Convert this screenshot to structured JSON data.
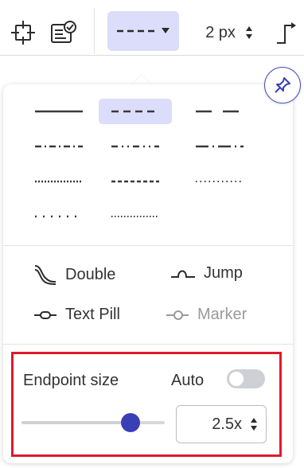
{
  "toolbar": {
    "width_value": "2 px",
    "icons": [
      "crop-frame-icon",
      "checklist-icon",
      "dash-style-dropdown-icon",
      "connector-icon"
    ]
  },
  "panel": {
    "patterns": [
      {
        "name": "solid",
        "selected": false
      },
      {
        "name": "dash",
        "selected": true
      },
      {
        "name": "long-dash",
        "selected": false
      },
      {
        "name": "dash-dot",
        "selected": false
      },
      {
        "name": "dash-dot-dot",
        "selected": false
      },
      {
        "name": "long-dash-dot",
        "selected": false
      },
      {
        "name": "dense-dot",
        "selected": false
      },
      {
        "name": "short-dash",
        "selected": false
      },
      {
        "name": "fine-dot",
        "selected": false
      },
      {
        "name": "sparse-dot",
        "selected": false
      },
      {
        "name": "micro-dot",
        "selected": false
      }
    ],
    "styles": {
      "double": "Double",
      "jump": "Jump",
      "text_pill": "Text Pill",
      "marker": "Marker"
    },
    "endpoint": {
      "label": "Endpoint size",
      "auto_label": "Auto",
      "auto_enabled": false,
      "slider_fraction": 0.76,
      "value": "2.5x"
    }
  },
  "colors": {
    "accent": "#3b3fb6",
    "selected_bg": "#dcddfb",
    "highlight_border": "#e0192c"
  }
}
